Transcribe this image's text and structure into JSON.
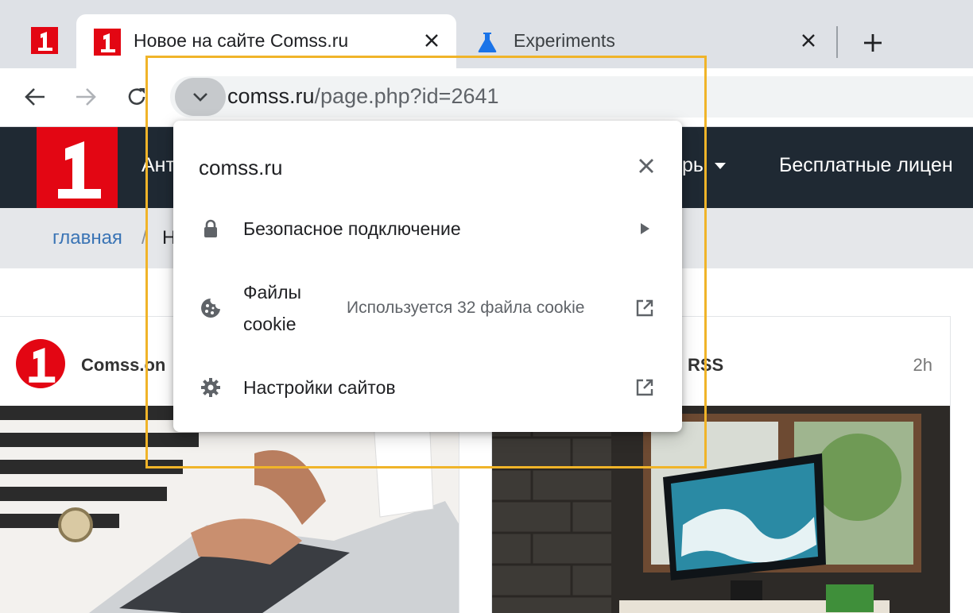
{
  "tabs": {
    "active_title": "Новое на сайте Comss.ru",
    "inactive_title": "Experiments"
  },
  "toolbar": {
    "url_host": "comss.ru",
    "url_path": "/page.php?id=2641"
  },
  "site": {
    "nav_items": [
      "Ант",
      "рь",
      "Бесплатные лицен"
    ],
    "breadcrumb_home": "главная",
    "breadcrumb_sep": "/",
    "breadcrumb_current": "Н",
    "cards": [
      {
        "author": "Comss.on",
        "time": ""
      },
      {
        "author": "RSS",
        "time": "2h"
      }
    ]
  },
  "popup": {
    "domain": "comss.ru",
    "rows": [
      {
        "label": "Безопасное подключение",
        "icon": "lock-icon",
        "action": "arrow-right-icon"
      },
      {
        "label": "Файлы cookie",
        "value": "Используется 32 файла cookie",
        "icon": "cookie-icon",
        "action": "external-link-icon"
      },
      {
        "label": "Настройки сайтов",
        "icon": "gear-icon",
        "action": "external-link-icon"
      }
    ]
  },
  "colors": {
    "brand_red": "#e30613",
    "nav_dark": "#1f2933",
    "highlight": "#f0b429",
    "link_blue": "#3a74b5"
  }
}
